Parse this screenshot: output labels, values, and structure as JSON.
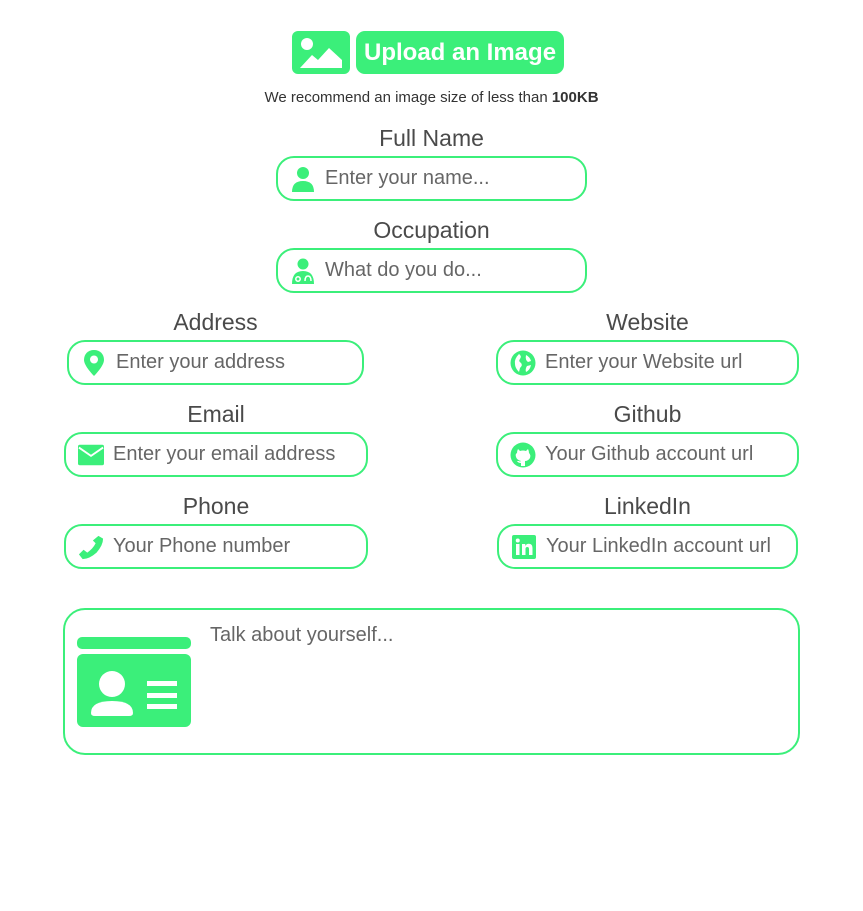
{
  "upload": {
    "button_label": "Upload an Image",
    "recommend_text": "We recommend an image size of less than ",
    "recommend_size": "100KB"
  },
  "theme": {
    "accent": "#3bef7a"
  },
  "fields": {
    "full_name": {
      "label": "Full Name",
      "placeholder": "Enter your name...",
      "icon": "user-icon"
    },
    "occupation": {
      "label": "Occupation",
      "placeholder": "What do you do...",
      "icon": "doctor-icon"
    },
    "address": {
      "label": "Address",
      "placeholder": "Enter your address",
      "icon": "map-pin-icon"
    },
    "website": {
      "label": "Website",
      "placeholder": "Enter your Website url",
      "icon": "globe-icon"
    },
    "email": {
      "label": "Email",
      "placeholder": "Enter your email address",
      "icon": "envelope-icon"
    },
    "github": {
      "label": "Github",
      "placeholder": "Your Github account url",
      "icon": "github-icon"
    },
    "phone": {
      "label": "Phone",
      "placeholder": "Your Phone number",
      "icon": "phone-icon"
    },
    "linkedin": {
      "label": "LinkedIn",
      "placeholder": "Your LinkedIn account url",
      "icon": "linkedin-icon"
    }
  },
  "about": {
    "placeholder": "Talk about yourself...",
    "icon": "id-card-icon"
  }
}
